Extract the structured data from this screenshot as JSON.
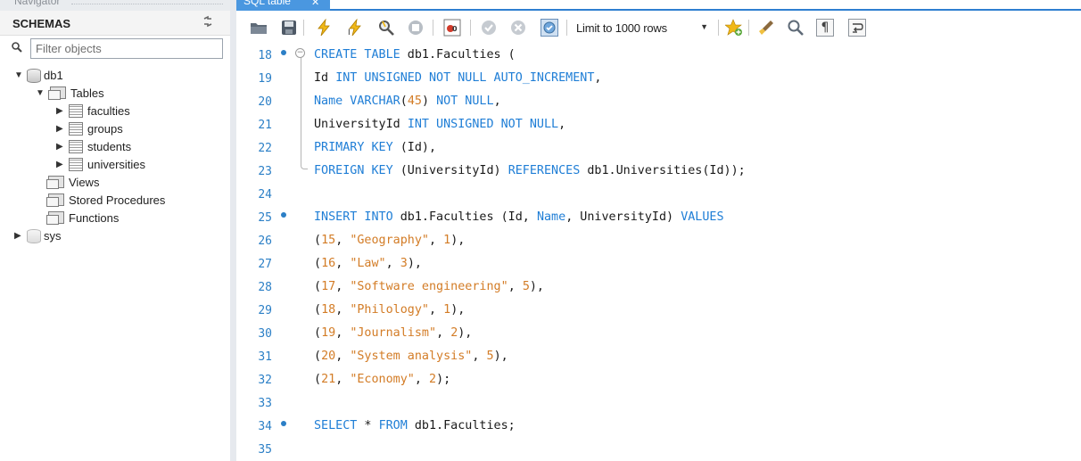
{
  "navigator": {
    "title": "Navigator",
    "schemas_label": "SCHEMAS",
    "filter_placeholder": "Filter objects",
    "tree": [
      {
        "label": "db1",
        "expanded": true,
        "type": "schema"
      },
      {
        "label": "Tables",
        "expanded": true,
        "type": "folder"
      },
      {
        "label": "faculties",
        "type": "table"
      },
      {
        "label": "groups",
        "type": "table"
      },
      {
        "label": "students",
        "type": "table"
      },
      {
        "label": "universities",
        "type": "table"
      },
      {
        "label": "Views",
        "type": "folder"
      },
      {
        "label": "Stored Procedures",
        "type": "folder"
      },
      {
        "label": "Functions",
        "type": "folder"
      },
      {
        "label": "sys",
        "expanded": false,
        "type": "schema"
      }
    ]
  },
  "tab": {
    "label": "SQL table",
    "close_icon": "close-icon"
  },
  "toolbar": {
    "limit_value": "Limit to 1000 rows",
    "icons": [
      "open-folder-icon",
      "save-icon",
      "execute-icon",
      "execute-current-icon",
      "explain-icon",
      "stop-icon",
      "toggle-error-icon",
      "commit-icon",
      "rollback-icon",
      "autocommit-icon",
      "add-snippet-icon",
      "beautify-icon",
      "find-icon",
      "invisible-chars-icon",
      "wrap-icon"
    ]
  },
  "editor": {
    "lines": [
      {
        "num": "18",
        "marker": true,
        "fold": true,
        "code": [
          [
            "kw",
            "CREATE TABLE"
          ],
          [
            "t",
            " db1.Faculties ("
          ]
        ]
      },
      {
        "num": "19",
        "code": [
          [
            "t",
            "Id "
          ],
          [
            "kw",
            "INT UNSIGNED NOT NULL AUTO_INCREMENT"
          ],
          [
            "t",
            ","
          ]
        ]
      },
      {
        "num": "20",
        "code": [
          [
            "kw",
            "Name VARCHAR"
          ],
          [
            "t",
            "("
          ],
          [
            "num",
            "45"
          ],
          [
            "t",
            ") "
          ],
          [
            "kw",
            "NOT NULL"
          ],
          [
            "t",
            ","
          ]
        ]
      },
      {
        "num": "21",
        "code": [
          [
            "t",
            "UniversityId "
          ],
          [
            "kw",
            "INT UNSIGNED NOT NULL"
          ],
          [
            "t",
            ","
          ]
        ]
      },
      {
        "num": "22",
        "code": [
          [
            "kw",
            "PRIMARY KEY"
          ],
          [
            "t",
            " (Id),"
          ]
        ]
      },
      {
        "num": "23",
        "code": [
          [
            "kw",
            "FOREIGN KEY"
          ],
          [
            "t",
            " (UniversityId) "
          ],
          [
            "kw",
            "REFERENCES"
          ],
          [
            "t",
            " db1.Universities(Id));"
          ]
        ]
      },
      {
        "num": "24",
        "code": []
      },
      {
        "num": "25",
        "marker": true,
        "code": [
          [
            "kw",
            "INSERT INTO"
          ],
          [
            "t",
            " db1.Faculties (Id, "
          ],
          [
            "kw",
            "Name"
          ],
          [
            "t",
            ", UniversityId) "
          ],
          [
            "kw",
            "VALUES"
          ]
        ]
      },
      {
        "num": "26",
        "code": [
          [
            "t",
            "("
          ],
          [
            "num",
            "15"
          ],
          [
            "t",
            ", "
          ],
          [
            "str",
            "\"Geography\""
          ],
          [
            "t",
            ", "
          ],
          [
            "num",
            "1"
          ],
          [
            "t",
            "),"
          ]
        ]
      },
      {
        "num": "27",
        "code": [
          [
            "t",
            "("
          ],
          [
            "num",
            "16"
          ],
          [
            "t",
            ", "
          ],
          [
            "str",
            "\"Law\""
          ],
          [
            "t",
            ", "
          ],
          [
            "num",
            "3"
          ],
          [
            "t",
            "),"
          ]
        ]
      },
      {
        "num": "28",
        "code": [
          [
            "t",
            "("
          ],
          [
            "num",
            "17"
          ],
          [
            "t",
            ", "
          ],
          [
            "str",
            "\"Software engineering\""
          ],
          [
            "t",
            ", "
          ],
          [
            "num",
            "5"
          ],
          [
            "t",
            "),"
          ]
        ]
      },
      {
        "num": "29",
        "code": [
          [
            "t",
            "("
          ],
          [
            "num",
            "18"
          ],
          [
            "t",
            ", "
          ],
          [
            "str",
            "\"Philology\""
          ],
          [
            "t",
            ", "
          ],
          [
            "num",
            "1"
          ],
          [
            "t",
            "),"
          ]
        ]
      },
      {
        "num": "30",
        "code": [
          [
            "t",
            "("
          ],
          [
            "num",
            "19"
          ],
          [
            "t",
            ", "
          ],
          [
            "str",
            "\"Journalism\""
          ],
          [
            "t",
            ", "
          ],
          [
            "num",
            "2"
          ],
          [
            "t",
            "),"
          ]
        ]
      },
      {
        "num": "31",
        "code": [
          [
            "t",
            "("
          ],
          [
            "num",
            "20"
          ],
          [
            "t",
            ", "
          ],
          [
            "str",
            "\"System analysis\""
          ],
          [
            "t",
            ", "
          ],
          [
            "num",
            "5"
          ],
          [
            "t",
            "),"
          ]
        ]
      },
      {
        "num": "32",
        "code": [
          [
            "t",
            "("
          ],
          [
            "num",
            "21"
          ],
          [
            "t",
            ", "
          ],
          [
            "str",
            "\"Economy\""
          ],
          [
            "t",
            ", "
          ],
          [
            "num",
            "2"
          ],
          [
            "t",
            ");"
          ]
        ]
      },
      {
        "num": "33",
        "code": []
      },
      {
        "num": "34",
        "marker": true,
        "code": [
          [
            "kw",
            "SELECT"
          ],
          [
            "t",
            " * "
          ],
          [
            "kw",
            "FROM"
          ],
          [
            "t",
            " db1.Faculties;"
          ]
        ]
      },
      {
        "num": "35",
        "code": []
      }
    ]
  },
  "colors": {
    "keyword": "#1f7ed6",
    "literal": "#d37c26",
    "line_number": "#2b7fc6",
    "tab_active": "#4a97e0"
  }
}
